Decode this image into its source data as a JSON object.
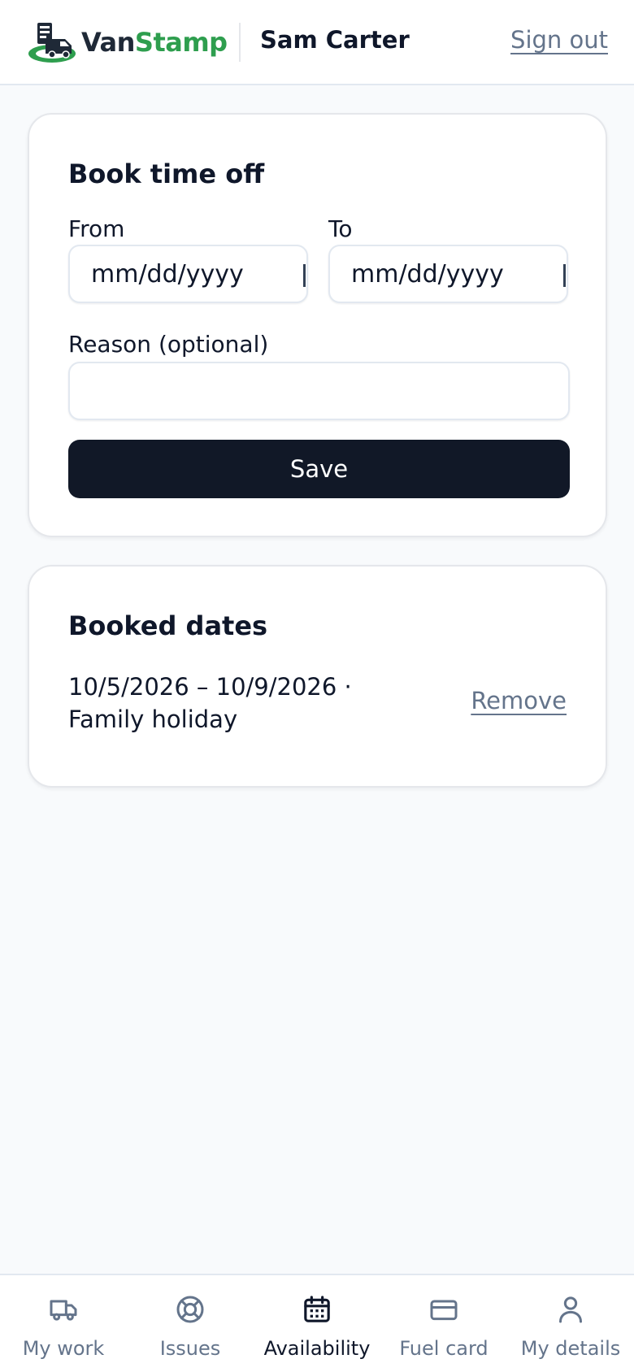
{
  "header": {
    "logo_text_part1": "Van",
    "logo_text_part2": "Stamp",
    "user_name": "Sam Carter",
    "sign_out_label": "Sign out"
  },
  "book_time_off": {
    "title": "Book time off",
    "from_label": "From",
    "from_placeholder": "mm/dd/yyyy",
    "to_label": "To",
    "to_placeholder": "mm/dd/yyyy",
    "reason_label": "Reason (optional)",
    "reason_value": "",
    "save_label": "Save"
  },
  "booked_dates": {
    "title": "Booked dates",
    "items": [
      {
        "text": "10/5/2026 – 10/9/2026 · Family holiday",
        "remove_label": "Remove"
      }
    ]
  },
  "bottom_nav": {
    "items": [
      {
        "label": "My work",
        "icon": "truck-icon",
        "active": false
      },
      {
        "label": "Issues",
        "icon": "lifebuoy-icon",
        "active": false
      },
      {
        "label": "Availability",
        "icon": "calendar-icon",
        "active": true
      },
      {
        "label": "Fuel card",
        "icon": "credit-card-icon",
        "active": false
      },
      {
        "label": "My details",
        "icon": "user-icon",
        "active": false
      }
    ]
  },
  "colors": {
    "brand_green": "#2e9e4e",
    "primary_button": "#111827",
    "muted_text": "#64748b",
    "page_background": "#f8fafc"
  }
}
